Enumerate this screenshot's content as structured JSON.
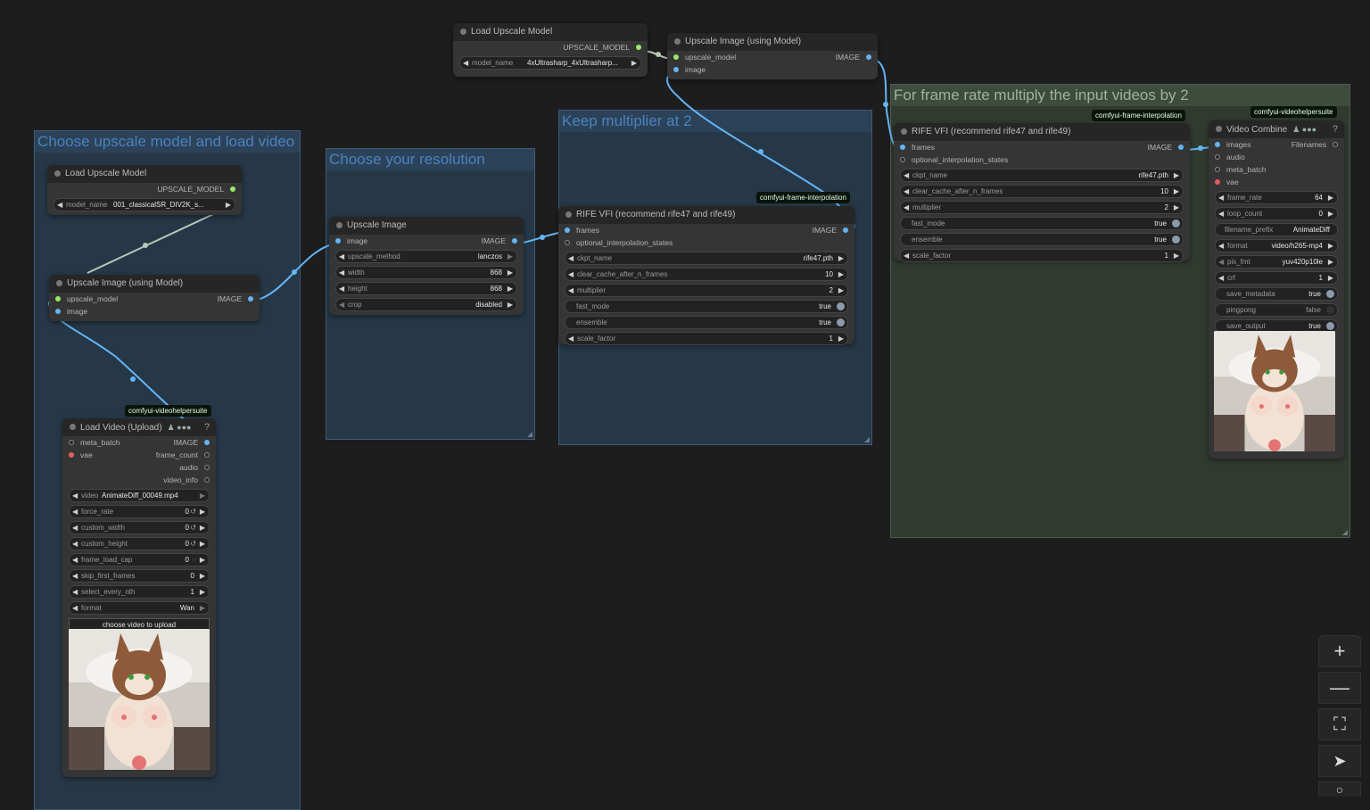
{
  "groups": {
    "g1": {
      "title": "Choose upscale model and load video"
    },
    "g2": {
      "title": "Choose your resolution"
    },
    "g3": {
      "title": "Keep multiplier at 2"
    },
    "g4": {
      "title": "For frame rate multiply the input videos by 2"
    }
  },
  "badges": {
    "rife_mid": "comfyui-frame-interpolation",
    "rife_right": "comfyui-frame-interpolation",
    "vhs_load": "comfyui-videohelpersuite",
    "vhs_combine": "comfyui-videohelpersuite"
  },
  "nodes": {
    "load_upscale_top": {
      "title": "Load Upscale Model",
      "out": "UPSCALE_MODEL",
      "w_model": {
        "label": "model_name",
        "value": "4xUltrasharp_4xUltrasharp..."
      }
    },
    "upscale_top": {
      "title": "Upscale Image (using Model)",
      "in1": "upscale_model",
      "in2": "image",
      "out": "IMAGE"
    },
    "load_upscale_left": {
      "title": "Load Upscale Model",
      "out": "UPSCALE_MODEL",
      "w_model": {
        "label": "model_name",
        "value": "001_classicalSR_DIV2K_s..."
      }
    },
    "upscale_left": {
      "title": "Upscale Image (using Model)",
      "in1": "upscale_model",
      "in2": "image",
      "out": "IMAGE"
    },
    "upscale_image": {
      "title": "Upscale Image",
      "in1": "image",
      "out": "IMAGE",
      "w_method": {
        "label": "upscale_method",
        "value": "lanczos"
      },
      "w_width": {
        "label": "width",
        "value": "868"
      },
      "w_height": {
        "label": "height",
        "value": "868"
      },
      "w_crop": {
        "label": "crop",
        "value": "disabled"
      }
    },
    "rife_mid": {
      "title": "RIFE VFI (recommend rife47 and rife49)",
      "in1": "frames",
      "in2": "optional_interpolation_states",
      "out": "IMAGE",
      "w_ckpt": {
        "label": "ckpt_name",
        "value": "rife47.pth"
      },
      "w_clear": {
        "label": "clear_cache_after_n_frames",
        "value": "10"
      },
      "w_mult": {
        "label": "multiplier",
        "value": "2"
      },
      "w_fast": {
        "label": "fast_mode",
        "value": "true"
      },
      "w_ens": {
        "label": "ensemble",
        "value": "true"
      },
      "w_scale": {
        "label": "scale_factor",
        "value": "1"
      }
    },
    "rife_right": {
      "title": "RIFE VFI (recommend rife47 and rife49)",
      "in1": "frames",
      "in2": "optional_interpolation_states",
      "out": "IMAGE",
      "w_ckpt": {
        "label": "ckpt_name",
        "value": "rife47.pth"
      },
      "w_clear": {
        "label": "clear_cache_after_n_frames",
        "value": "10"
      },
      "w_mult": {
        "label": "multiplier",
        "value": "2"
      },
      "w_fast": {
        "label": "fast_mode",
        "value": "true"
      },
      "w_ens": {
        "label": "ensemble",
        "value": "true"
      },
      "w_scale": {
        "label": "scale_factor",
        "value": "1"
      }
    },
    "load_video": {
      "title": "Load Video (Upload)",
      "title_icons": "♟ ●●●",
      "help": "?",
      "in1": "meta_batch",
      "in2": "vae",
      "out1": "IMAGE",
      "out2": "frame_count",
      "out3": "audio",
      "out4": "video_info",
      "w_video": {
        "label": "video",
        "value": "AnimateDiff_00049.mp4"
      },
      "w_force_rate": {
        "label": "force_rate",
        "value": "0"
      },
      "w_custom_width": {
        "label": "custom_width",
        "value": "0"
      },
      "w_custom_height": {
        "label": "custom_height",
        "value": "0"
      },
      "w_frame_load_cap": {
        "label": "frame_load_cap",
        "value": "0"
      },
      "w_skip": {
        "label": "skip_first_frames",
        "value": "0"
      },
      "w_nth": {
        "label": "select_every_nth",
        "value": "1"
      },
      "w_format": {
        "label": "format",
        "value": "Wan"
      },
      "button": "choose video to upload"
    },
    "video_combine": {
      "title": "Video Combine",
      "title_icons": "♟ ●●●",
      "help": "?",
      "in1": "images",
      "in2": "audio",
      "in3": "meta_batch",
      "in4": "vae",
      "out": "Filenames",
      "w_frame_rate": {
        "label": "frame_rate",
        "value": "64"
      },
      "w_loop": {
        "label": "loop_count",
        "value": "0"
      },
      "w_prefix": {
        "label": "filename_prefix",
        "value": "AnimateDiff"
      },
      "w_format": {
        "label": "format",
        "value": "video/h265-mp4"
      },
      "w_pix": {
        "label": "pix_fmt",
        "value": "yuv420p10le"
      },
      "w_crf": {
        "label": "crf",
        "value": "1"
      },
      "w_save_meta": {
        "label": "save_metadata",
        "value": "true"
      },
      "w_ping": {
        "label": "pingpong",
        "value": "false"
      },
      "w_save_out": {
        "label": "save_output",
        "value": "true"
      }
    }
  },
  "toolbar": {
    "zoom_in": "+",
    "zoom_out": "—",
    "fit": "⛶",
    "locate": "➤"
  },
  "colors": {
    "canvas": "#1d1d1d",
    "group_blue": "#263747",
    "group_green": "#303a30",
    "link_image": "#64b5f6",
    "link_model": "#b7c9b7",
    "badge_bg": "#0a140a"
  },
  "icons": [
    "plus-icon",
    "minus-icon",
    "fit-view-icon",
    "locate-icon",
    "help-icon",
    "resize-handle-icon"
  ]
}
